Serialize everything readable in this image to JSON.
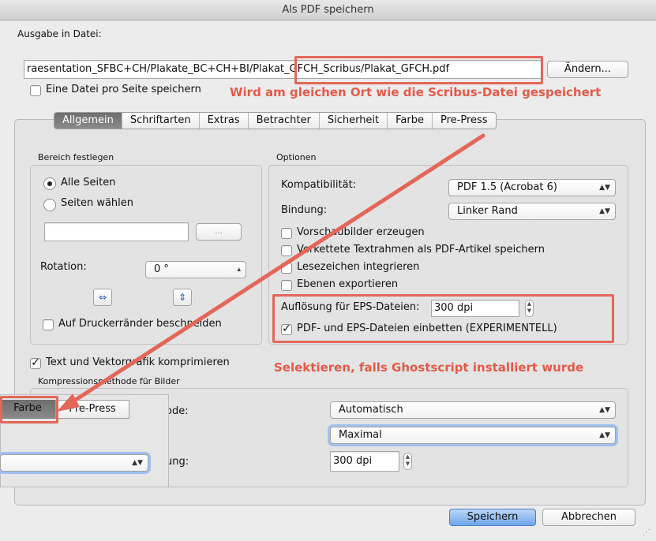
{
  "window": {
    "title": "Als PDF speichern"
  },
  "output": {
    "label": "Ausgabe in Datei:",
    "path_prefix": "raesentation_SFBC+CH/Plakate_BC+CH+BI/",
    "path_highlight": "Plakat_GFCH_Scribus/Plakat_GFCH.pdf",
    "change_button": "Ändern...",
    "one_file_per_page": "Eine Datei pro Seite speichern"
  },
  "tabs": [
    {
      "label": "Allgemein",
      "selected": true
    },
    {
      "label": "Schriftarten",
      "selected": false
    },
    {
      "label": "Extras",
      "selected": false
    },
    {
      "label": "Betrachter",
      "selected": false
    },
    {
      "label": "Sicherheit",
      "selected": false
    },
    {
      "label": "Farbe",
      "selected": false
    },
    {
      "label": "Pre-Press",
      "selected": false
    }
  ],
  "range": {
    "title": "Bereich festlegen",
    "all_pages": "Alle Seiten",
    "choose_pages": "Seiten wählen",
    "pages_value": "",
    "browse": "...",
    "rotation_label": "Rotation:",
    "rotation_value": "0 °",
    "crop_to_printer": "Auf Druckerränder beschneiden"
  },
  "options": {
    "title": "Optionen",
    "compat_label": "Kompatibilität:",
    "compat_value": "PDF 1.5 (Acrobat 6)",
    "binding_label": "Bindung:",
    "binding_value": "Linker Rand",
    "thumbnails": "Vorschaubilder erzeugen",
    "linked_frames": "Verkettete Textrahmen als PDF-Artikel speichern",
    "bookmarks": "Lesezeichen integrieren",
    "layers": "Ebenen exportieren",
    "eps_res_label": "Auflösung für EPS-Dateien:",
    "eps_res_value": "300 dpi",
    "embed_eps": "PDF- und EPS-Dateien einbetten (EXPERIMENTELL)"
  },
  "compression": {
    "compress_text": "Text und Vektorgrafik komprimieren",
    "method_title": "Kompressionsmethode für Bilder",
    "method_label_tail": "ode:",
    "method_value": "Automatisch",
    "quality_value": "Maximal",
    "resample_label_tail": "ung:",
    "resample_value": "300 dpi"
  },
  "inset": {
    "tab_farbe": "Farbe",
    "tab_prepress": "Pre-Press"
  },
  "annotations": {
    "same_location": "Wird am gleichen Ort wie die Scribus-Datei gespeichert",
    "select_ghostscript": "Selektieren, falls Ghostscript installiert wurde"
  },
  "footer": {
    "save": "Speichern",
    "cancel": "Abbrechen"
  },
  "colors": {
    "annotation_red": "#e36759",
    "accent_blue": "#6fa5ec"
  }
}
